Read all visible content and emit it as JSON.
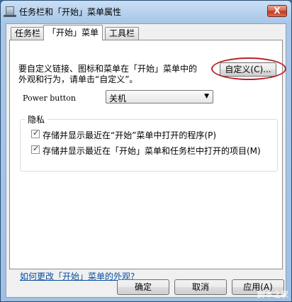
{
  "window": {
    "title": "任务栏和「开始」菜单属性",
    "close_glyph": "X"
  },
  "tabs": [
    {
      "label": "任务栏",
      "active": false
    },
    {
      "label": "「开始」菜单",
      "active": true
    },
    {
      "label": "工具栏",
      "active": false
    }
  ],
  "start_menu": {
    "description_line1": "要自定义链接、图标和菜单在「开始」菜单中的",
    "description_line2": "外观和行为，请单击“自定义”。",
    "customize_label": "自定义(C)...",
    "power_button_label": "Power button",
    "power_button_value": "关机",
    "privacy_title": "隐私",
    "privacy_option1": "存储并显示最近在“开始”菜单中打开的程序(P)",
    "privacy_option1_checked": true,
    "privacy_option2": "存储并显示最近在「开始」菜单和任务栏中打开的项目(M)",
    "privacy_option2_checked": true,
    "help_link": "如何更改「开始」菜单的外观?"
  },
  "footer": {
    "ok_label": "确定",
    "cancel_label": "取消",
    "apply_label": "应用(A)"
  },
  "watermark": "脚本之家",
  "colors": {
    "link": "#0a4ea0",
    "highlight_ring": "#b5242a",
    "close_button": "#c0391f"
  }
}
